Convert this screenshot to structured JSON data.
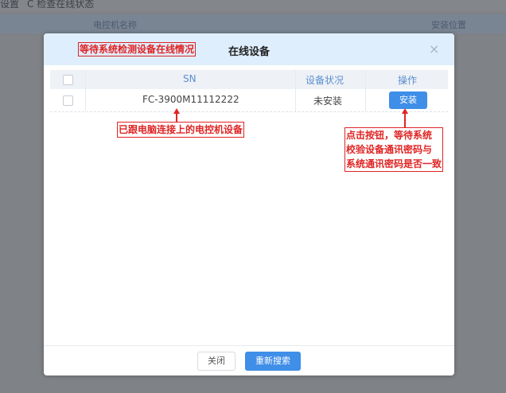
{
  "background": {
    "toolbar_left": "设置",
    "toolbar_refresh": "C 检查在线状态",
    "column_motor_name": "电控机名称",
    "column_install_location": "安装位置"
  },
  "modal": {
    "title": "在线设备",
    "close_icon": "×",
    "table": {
      "headers": [
        "",
        "SN",
        "设备状况",
        "操作"
      ],
      "rows": [
        {
          "sn": "FC-3900M11112222",
          "status": "未安装",
          "action": "安装"
        }
      ]
    },
    "footer": {
      "close_label": "关闭",
      "research_label": "重新搜索"
    }
  },
  "annotations": {
    "top": "等待系统检测设备在线情况",
    "sn": "已跟电脑连接上的电控机设备",
    "install": [
      "点击按钮，等待系统",
      "校验设备通讯密码与",
      "系统通讯密码是否一致"
    ]
  },
  "colors": {
    "accent": "#3f8ee8",
    "annotation": "#e02424",
    "header_bg": "#dfeefc",
    "overlay": "#7f8286"
  }
}
